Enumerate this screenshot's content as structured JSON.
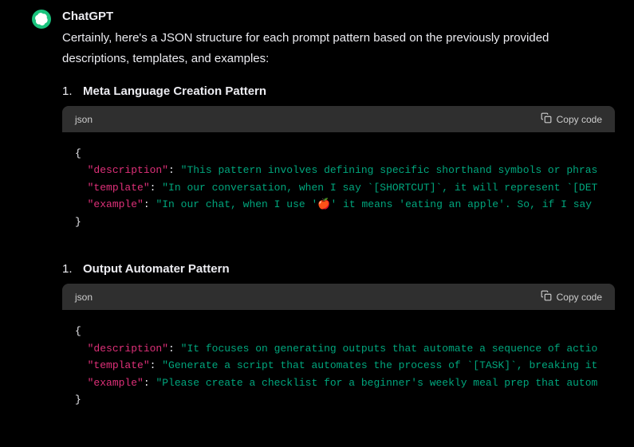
{
  "author": "ChatGPT",
  "intro": "Certainly, here's a JSON structure for each prompt pattern based on the previously provided descriptions, templates, and examples:",
  "copy_label": "Copy code",
  "lang": "json",
  "sections": [
    {
      "num": "1.",
      "title": "Meta Language Creation Pattern",
      "code": {
        "open": "{",
        "keys": {
          "description": "\"description\"",
          "template": "\"template\"",
          "example": "\"example\""
        },
        "vals": {
          "description": "\"This pattern involves defining specific shorthand symbols or phras",
          "template": "\"In our conversation, when I say `[SHORTCUT]`, it will represent `[DET",
          "example": "\"In our chat, when I use '🍎' it means 'eating an apple'. So, if I say "
        },
        "close": "}"
      }
    },
    {
      "num": "1.",
      "title": "Output Automater Pattern",
      "code": {
        "open": "{",
        "keys": {
          "description": "\"description\"",
          "template": "\"template\"",
          "example": "\"example\""
        },
        "vals": {
          "description": "\"It focuses on generating outputs that automate a sequence of actio",
          "template": "\"Generate a script that automates the process of `[TASK]`, breaking it",
          "example": "\"Please create a checklist for a beginner's weekly meal prep that autom"
        },
        "close": "}"
      }
    }
  ]
}
